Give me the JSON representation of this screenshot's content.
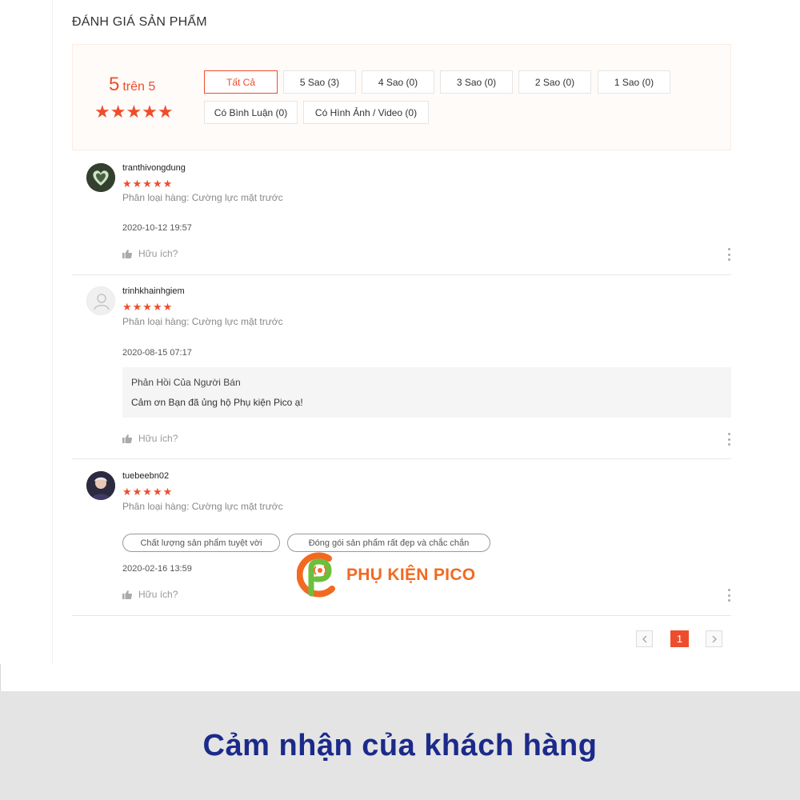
{
  "section_title": "ĐÁNH GIÁ SẢN PHẨM",
  "summary": {
    "score": "5",
    "out_of": "trên 5",
    "stars": "★★★★★",
    "star_rating": 5
  },
  "filters": [
    {
      "label": "Tất Cả",
      "active": true
    },
    {
      "label": "5 Sao (3)",
      "active": false
    },
    {
      "label": "4 Sao (0)",
      "active": false
    },
    {
      "label": "3 Sao (0)",
      "active": false
    },
    {
      "label": "2 Sao (0)",
      "active": false
    },
    {
      "label": "1 Sao (0)",
      "active": false
    },
    {
      "label": "Có Bình Luận (0)",
      "active": false
    },
    {
      "label": "Có Hình Ảnh / Video (0)",
      "active": false
    }
  ],
  "reviews": [
    {
      "username": "tranthivongdung",
      "stars": "★★★★★",
      "variation": "Phân loại hàng: Cường lực mặt trước",
      "date": "2020-10-12 19:57",
      "helpful": "Hữu ích?"
    },
    {
      "username": "trinhkhainhgiem",
      "stars": "★★★★★",
      "variation": "Phân loại hàng: Cường lực mặt trước",
      "date": "2020-08-15 07:17",
      "reply_title": "Phản Hồi Của Người Bán",
      "reply_text": "Cảm ơn Bạn đã ủng hộ Phụ kiện Pico ạ!",
      "helpful": "Hữu ích?"
    },
    {
      "username": "tuebeebn02",
      "stars": "★★★★★",
      "variation": "Phân loại hàng: Cường lực mặt trước",
      "tags": [
        "Chất lượng sản phẩm tuyệt vời",
        "Đóng gói sản phẩm rất đẹp và chắc chắn"
      ],
      "date": "2020-02-16 13:59",
      "helpful": "Hữu ích?"
    }
  ],
  "pagination": {
    "current_page": "1",
    "prev_icon": "chevron-left-icon",
    "next_icon": "chevron-right-icon"
  },
  "watermark": "PHỤ KIỆN PICO",
  "footer": "Cảm nhận của khách hàng",
  "colors": {
    "accent": "#ee4d2d",
    "rating_bg": "#fffbf8",
    "footer_bg": "#e4e4e4",
    "footer_text": "#1b2a8a",
    "brand_orange": "#f26a21",
    "brand_green": "#6cbf3c"
  }
}
